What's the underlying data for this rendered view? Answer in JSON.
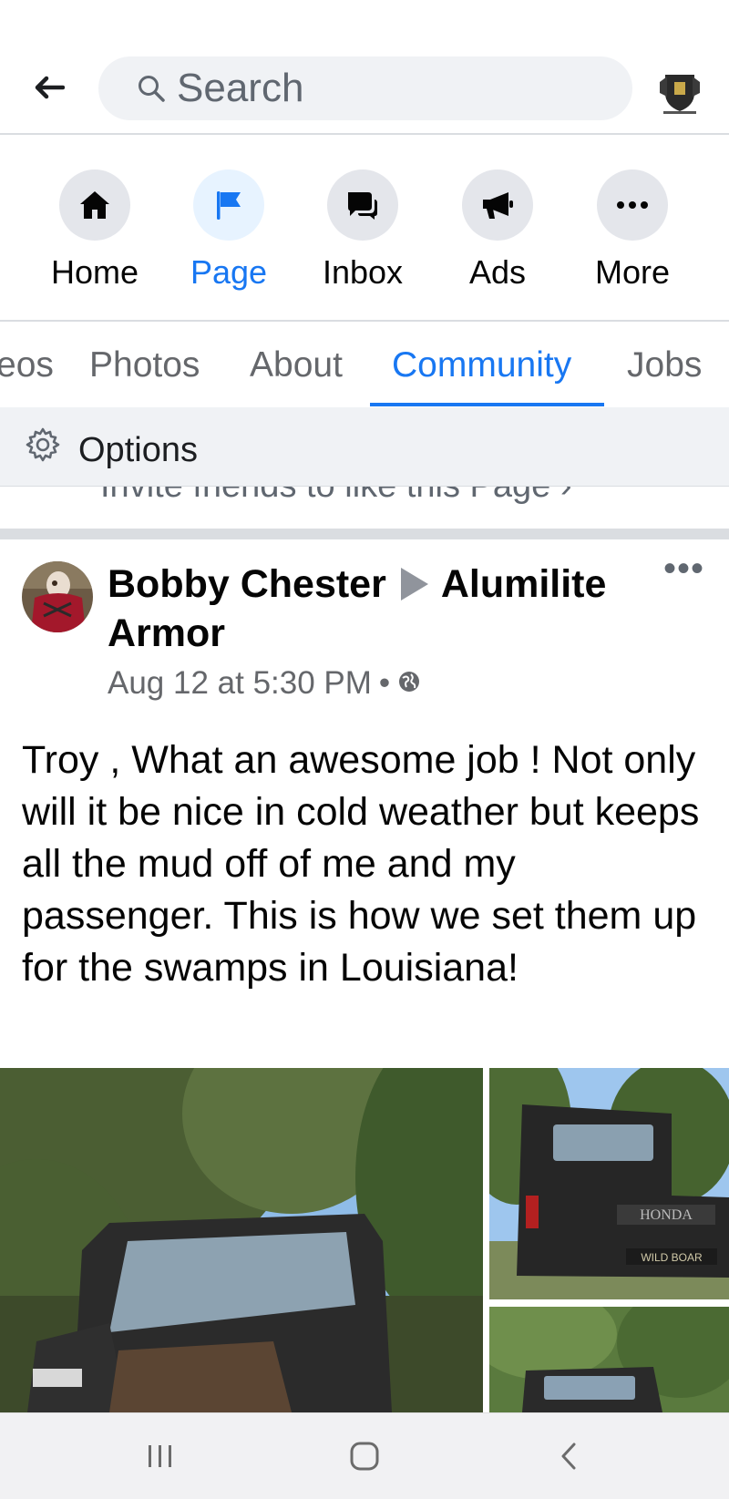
{
  "search": {
    "placeholder": "Search"
  },
  "nav": {
    "items": [
      {
        "label": "Home",
        "icon": "home-icon",
        "active": false
      },
      {
        "label": "Page",
        "icon": "flag-icon",
        "active": true
      },
      {
        "label": "Inbox",
        "icon": "chat-icon",
        "active": false
      },
      {
        "label": "Ads",
        "icon": "megaphone-icon",
        "active": false
      },
      {
        "label": "More",
        "icon": "more-dots-icon",
        "active": false
      }
    ]
  },
  "tabs": {
    "items": [
      {
        "label": "eos",
        "active": false
      },
      {
        "label": "Photos",
        "active": false
      },
      {
        "label": "About",
        "active": false
      },
      {
        "label": "Community",
        "active": true
      },
      {
        "label": "Jobs",
        "active": false
      }
    ]
  },
  "options": {
    "label": "Options"
  },
  "invite": {
    "label": "Invite friends to like this Page ›"
  },
  "post": {
    "author": "Bobby Chester",
    "target": "Alumilite Armor",
    "timestamp": "Aug 12 at 5:30 PM",
    "more": "•••",
    "text": "Troy , What an awesome job ! Not only will it be nice in cold weather but keeps all the mud off of me and my passenger. This is how we set them up for the swamps in Louisiana!"
  },
  "photos": {
    "top_right_brand": "HONDA",
    "top_right_plate": "WILD BOAR"
  },
  "colors": {
    "accent": "#1877f2",
    "nav_circle": "#e4e6eb",
    "muted_text": "#65676b"
  }
}
